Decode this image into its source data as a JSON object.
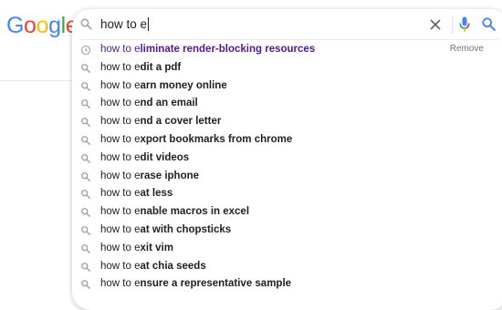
{
  "logo": {
    "text": "Google",
    "colors": [
      "#4285F4",
      "#EA4335",
      "#FBBC05",
      "#4285F4",
      "#34A853",
      "#EA4335"
    ]
  },
  "search": {
    "query": "how to e",
    "icon": "search-icon",
    "clear_icon": "close-icon",
    "voice_icon": "microphone-icon",
    "submit_icon": "search-icon",
    "accent_color": "#4285F4"
  },
  "suggestions": [
    {
      "typed": "how to e",
      "rest": "liminate render-blocking resources",
      "type": "history",
      "icon": "history-icon",
      "action": "Remove"
    },
    {
      "typed": "how to e",
      "rest": "dit a pdf",
      "type": "suggestion",
      "icon": "search-icon"
    },
    {
      "typed": "how to e",
      "rest": "arn money online",
      "type": "suggestion",
      "icon": "search-icon"
    },
    {
      "typed": "how to e",
      "rest": "nd an email",
      "type": "suggestion",
      "icon": "search-icon"
    },
    {
      "typed": "how to e",
      "rest": "nd a cover letter",
      "type": "suggestion",
      "icon": "search-icon"
    },
    {
      "typed": "how to e",
      "rest": "xport bookmarks from chrome",
      "type": "suggestion",
      "icon": "search-icon"
    },
    {
      "typed": "how to e",
      "rest": "dit videos",
      "type": "suggestion",
      "icon": "search-icon"
    },
    {
      "typed": "how to e",
      "rest": "rase iphone",
      "type": "suggestion",
      "icon": "search-icon"
    },
    {
      "typed": "how to e",
      "rest": "at less",
      "type": "suggestion",
      "icon": "search-icon"
    },
    {
      "typed": "how to e",
      "rest": "nable macros in excel",
      "type": "suggestion",
      "icon": "search-icon"
    },
    {
      "typed": "how to e",
      "rest": "at with chopsticks",
      "type": "suggestion",
      "icon": "search-icon"
    },
    {
      "typed": "how to e",
      "rest": "xit vim",
      "type": "suggestion",
      "icon": "search-icon"
    },
    {
      "typed": "how to e",
      "rest": "at chia seeds",
      "type": "suggestion",
      "icon": "search-icon"
    },
    {
      "typed": "how to e",
      "rest": "nsure a representative sample",
      "type": "suggestion",
      "icon": "search-icon"
    }
  ]
}
